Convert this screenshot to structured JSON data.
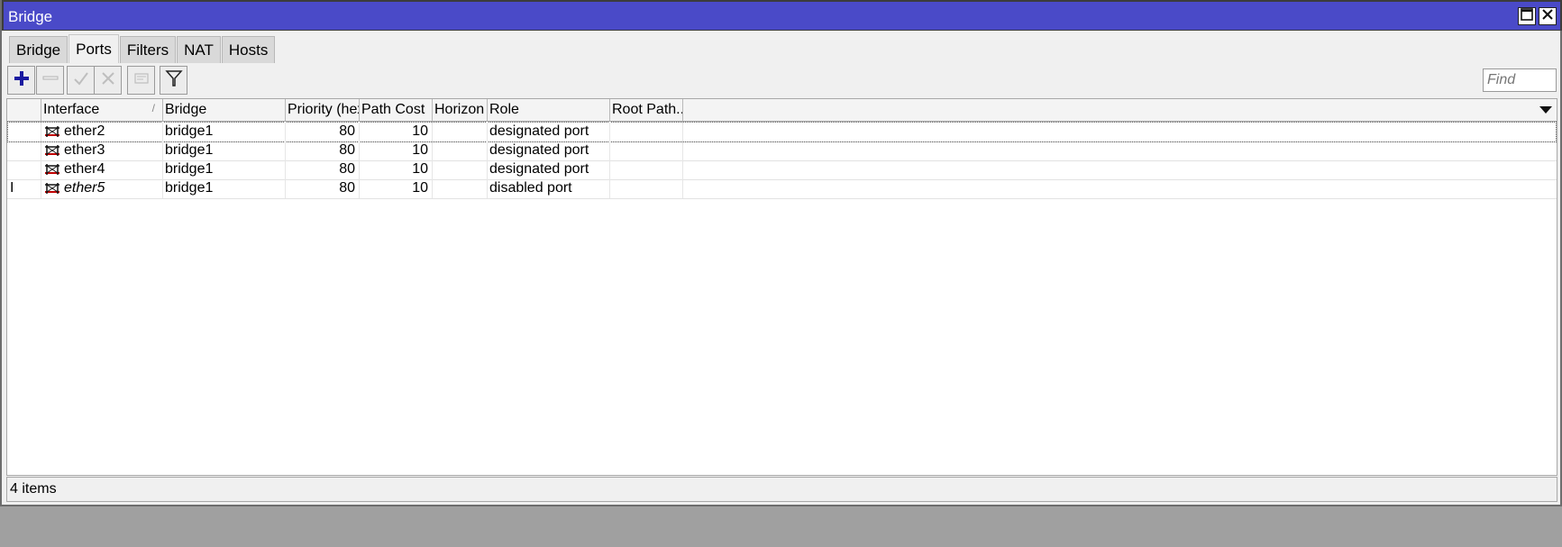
{
  "window": {
    "title": "Bridge",
    "buttons": {
      "maximize_icon": "maximize-icon",
      "close_icon": "close-icon"
    }
  },
  "tabs": [
    {
      "label": "Bridge",
      "active": false
    },
    {
      "label": "Ports",
      "active": true
    },
    {
      "label": "Filters",
      "active": false
    },
    {
      "label": "NAT",
      "active": false
    },
    {
      "label": "Hosts",
      "active": false
    }
  ],
  "toolbar": {
    "buttons": [
      {
        "name": "add",
        "icon": "plus-icon",
        "enabled": true
      },
      {
        "name": "remove",
        "icon": "minus-icon",
        "enabled": false
      },
      {
        "name": "enable",
        "icon": "check-icon",
        "enabled": false
      },
      {
        "name": "disable",
        "icon": "x-icon",
        "enabled": false
      },
      {
        "name": "comment",
        "icon": "comment-icon",
        "enabled": false
      },
      {
        "name": "filter",
        "icon": "filter-icon",
        "enabled": true
      }
    ],
    "find_placeholder": "Find"
  },
  "table": {
    "columns": [
      "",
      "Interface",
      "Bridge",
      "Priority (hex)",
      "Path Cost",
      "Horizon",
      "Role",
      "Root Path..."
    ],
    "sort_column": "Interface",
    "rows": [
      {
        "flag": "",
        "interface": "ether2",
        "bridge": "bridge1",
        "priority": "80",
        "path_cost": "10",
        "horizon": "",
        "role": "designated port",
        "root_path": "",
        "disabled": false
      },
      {
        "flag": "",
        "interface": "ether3",
        "bridge": "bridge1",
        "priority": "80",
        "path_cost": "10",
        "horizon": "",
        "role": "designated port",
        "root_path": "",
        "disabled": false
      },
      {
        "flag": "",
        "interface": "ether4",
        "bridge": "bridge1",
        "priority": "80",
        "path_cost": "10",
        "horizon": "",
        "role": "designated port",
        "root_path": "",
        "disabled": false
      },
      {
        "flag": "I",
        "interface": "ether5",
        "bridge": "bridge1",
        "priority": "80",
        "path_cost": "10",
        "horizon": "",
        "role": "disabled port",
        "root_path": "",
        "disabled": true
      }
    ]
  },
  "status": {
    "text": "4 items"
  },
  "colors": {
    "titlebar": "#4a4ac8",
    "plus": "#1a1aa0",
    "port_icon": "#c00000"
  }
}
